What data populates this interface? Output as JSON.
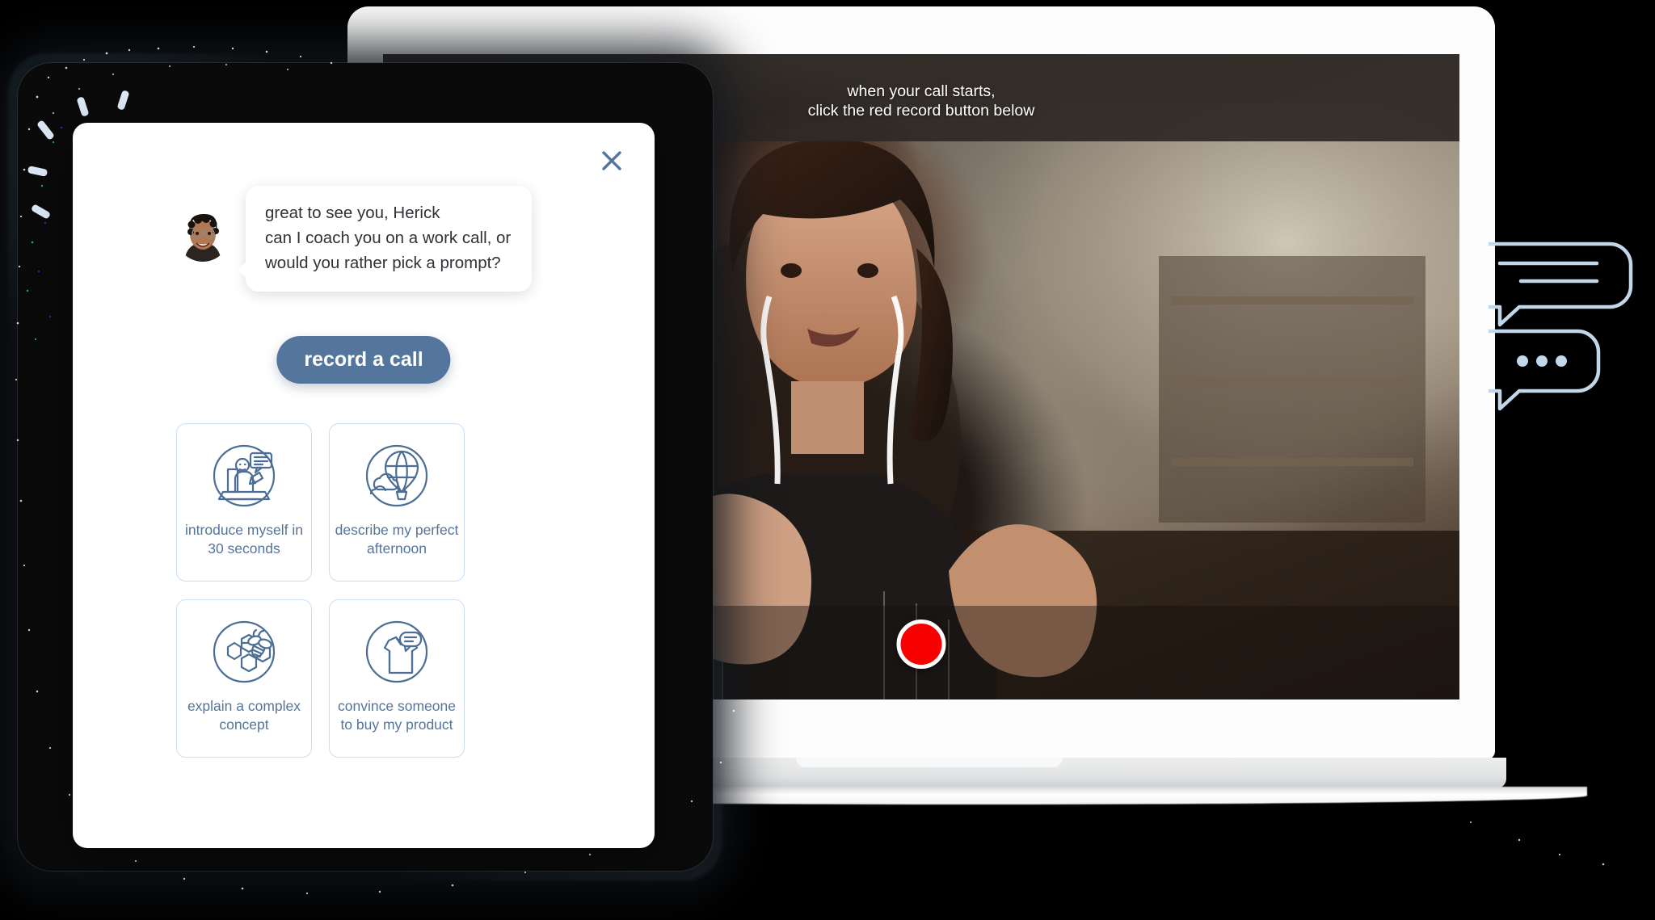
{
  "video_panel": {
    "caption_line1": "when your call starts,",
    "caption_line2": "click the red record button below",
    "back_icon": "chevron-left-icon",
    "record_icon": "record-circle-icon"
  },
  "modal": {
    "close_icon": "close-icon",
    "avatar_icon": "coach-avatar",
    "message_line1": "great to see you, Herick",
    "message_line2": "can I coach you on a work call, or",
    "message_line3": "would you rather pick a prompt?",
    "primary_button": "record a call",
    "prompts": [
      {
        "label_line1": "introduce myself in",
        "label_line2": "30 seconds",
        "icon": "person-at-laptop-icon"
      },
      {
        "label_line1": "describe my perfect",
        "label_line2": "afternoon",
        "icon": "hot-air-balloon-icon"
      },
      {
        "label_line1": "explain a complex",
        "label_line2": "concept",
        "icon": "honeycomb-bee-icon"
      },
      {
        "label_line1": "convince someone",
        "label_line2": "to buy my product",
        "icon": "shirt-speech-icon"
      }
    ]
  },
  "decorations": {
    "chat_bubble_top": "chat-bubble-lines-icon",
    "chat_bubble_bottom": "chat-bubble-dots-icon"
  },
  "colors": {
    "accent_blue": "#54769c",
    "card_border": "#cddef0",
    "record_red": "#f90000",
    "deco_blue": "#c3d7ea"
  }
}
